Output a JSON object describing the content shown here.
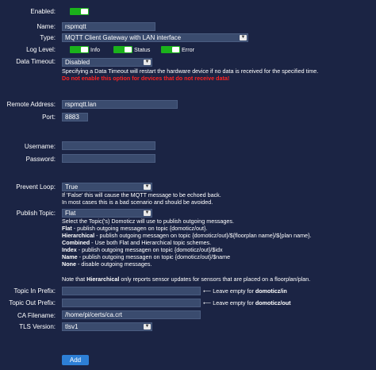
{
  "enabled": {
    "label": "Enabled:",
    "on": true
  },
  "name": {
    "label": "Name:",
    "value": "rspmqtt"
  },
  "type": {
    "label": "Type:",
    "value": "MQTT Client Gateway with LAN interface"
  },
  "log_level": {
    "label": "Log Level:",
    "options": [
      {
        "label": "Info",
        "on": true
      },
      {
        "label": "Status",
        "on": true
      },
      {
        "label": "Error",
        "on": true
      }
    ]
  },
  "data_timeout": {
    "label": "Data Timeout:",
    "value": "Disabled",
    "help": "Specifying a Data Timeout will restart the hardware device if no data is received for the specified time.",
    "warning": "Do not enable this option for devices that do not receive data!"
  },
  "remote_address": {
    "label": "Remote Address:",
    "value": "rspmqtt.lan"
  },
  "port": {
    "label": "Port:",
    "value": "8883"
  },
  "username": {
    "label": "Username:",
    "value": ""
  },
  "password": {
    "label": "Password:",
    "value": ""
  },
  "prevent_loop": {
    "label": "Prevent Loop:",
    "value": "True",
    "help1": "If 'False' this will cause the MQTT message to be echoed back.",
    "help2": "In most cases this is a bad scenario and should be avoided."
  },
  "publish_topic": {
    "label": "Publish Topic:",
    "value": "Flat",
    "intro": "Select the Topic('s) Domoticz will use to publish outgoing messages.",
    "lines": [
      {
        "bold": "Flat",
        "rest": " - publish outgoing messagen on topic {domoticz/out}."
      },
      {
        "bold": "Hierarchical",
        "rest": " - publish outgoing messagen on topic {domoticz/out}/${floorplan name}/${plan name}."
      },
      {
        "bold": "Combined",
        "rest": " - Use both Flat and Hierarchical topic schemes."
      },
      {
        "bold": "Index",
        "rest": " - publish outgoing messagen on topic {domoticz/out}/$idx"
      },
      {
        "bold": "Name",
        "rest": " - publish outgoing messagen on topic {domoticz/out}/$name"
      },
      {
        "bold": "None",
        "rest": " - disable outgoing messages."
      }
    ],
    "note_pre": "Note that ",
    "note_bold": "Hierarchical",
    "note_post": " only reports sensor updates for sensors that are placed on a floorplan/plan."
  },
  "topic_in_prefix": {
    "label": "Topic In Prefix:",
    "value": "",
    "hint_pre": "⟵ Leave empty for ",
    "hint_bold": "domoticz/in"
  },
  "topic_out_prefix": {
    "label": "Topic Out Prefix:",
    "value": "",
    "hint_pre": "⟵ Leave empty for ",
    "hint_bold": "domoticz/out"
  },
  "ca_filename": {
    "label": "CA Filename:",
    "value": "/home/pi/certs/ca.crt"
  },
  "tls_version": {
    "label": "TLS Version:",
    "value": "tlsv1"
  },
  "add_button": {
    "label": "Add"
  },
  "colors": {
    "background": "#1b2444",
    "toggle_on": "#1bb21b",
    "warning": "#ff2222",
    "button": "#2d7fd6",
    "field": "#3a4b6e"
  },
  "icons": {
    "select_caret": "chevron-down-icon",
    "arrow": "left-arrow-icon"
  }
}
